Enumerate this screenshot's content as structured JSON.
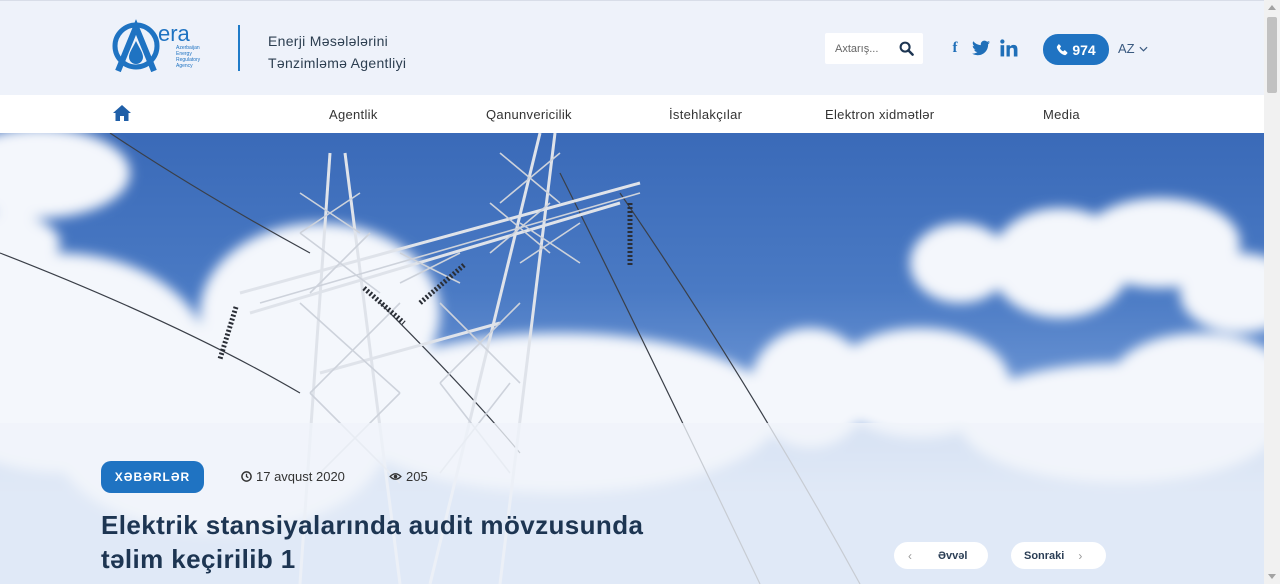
{
  "header": {
    "logo_text": "era",
    "logo_subtitle": [
      "Azerbaijan",
      "Energy",
      "Regulatory",
      "Agency"
    ],
    "agency_name_line1": "Enerji Məsələlərini",
    "agency_name_line2": "Tənzimləmə Agentliyi",
    "search_placeholder": "Axtarış...",
    "phone_label": "974",
    "language": "AZ",
    "social": [
      "facebook-icon",
      "twitter-icon",
      "linkedin-icon"
    ],
    "accent_color": "#1f73c2"
  },
  "nav": {
    "items": [
      {
        "label": "Agentlik"
      },
      {
        "label": "Qanunvericilik"
      },
      {
        "label": "İstehlakçılar"
      },
      {
        "label": "Elektron xidmətlər"
      },
      {
        "label": "Media"
      }
    ]
  },
  "article": {
    "category": "XƏBƏRLƏR",
    "date": "17 avqust 2020",
    "views": "205",
    "title_line1": "Elektrik stansiyalarında audit mövzusunda",
    "title_line2": "təlim keçirilib 1",
    "prev_label": "Əvvəl",
    "next_label": "Sonraki"
  }
}
